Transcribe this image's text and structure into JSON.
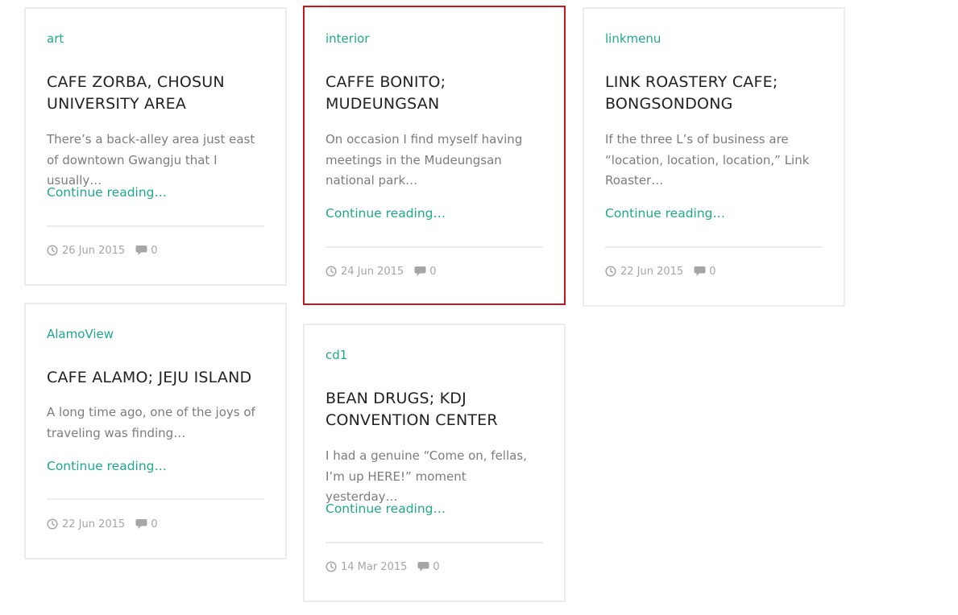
{
  "colors": {
    "accent": "#1eaa8a",
    "highlight_border": "#c8161d",
    "muted": "#a6a6a6"
  },
  "icons": {
    "date": "clock-icon",
    "comments": "comment-bubble-icon"
  },
  "posts": [
    {
      "category": "art",
      "title": "CAFE ZORBA, CHOSUN UNIVERSITY AREA",
      "excerpt": "There’s a back-alley area just east of downtown Gwangju that I usually…",
      "more": "Continue reading…",
      "date": "26 Jun 2015",
      "comments": "0"
    },
    {
      "category": "interior",
      "title": "CAFFE BONITO; MUDEUNGSAN",
      "excerpt": "On occasion I find myself having meetings in the Mudeungsan national park…",
      "more": "Continue reading…",
      "date": "24 Jun 2015",
      "comments": "0"
    },
    {
      "category": "linkmenu",
      "title": "LINK ROASTERY CAFE; BONGSONDONG",
      "excerpt": "If the three L’s of business are “location, location, location,” Link Roaster…",
      "more": "Continue reading…",
      "date": "22 Jun 2015",
      "comments": "0"
    },
    {
      "category": "AlamoView",
      "title": "CAFE ALAMO; JEJU ISLAND",
      "excerpt": "A long time ago, one of the joys of traveling was finding…",
      "more": "Continue reading…",
      "date": "22 Jun 2015",
      "comments": "0"
    },
    {
      "category": "cd1",
      "title": "BEAN DRUGS; KDJ CONVENTION CENTER",
      "excerpt": "I had a genuine “Come on, fellas, I’m up HERE!” moment yesterday…",
      "more": "Continue reading…",
      "date": "14 Mar 2015",
      "comments": "0"
    }
  ]
}
